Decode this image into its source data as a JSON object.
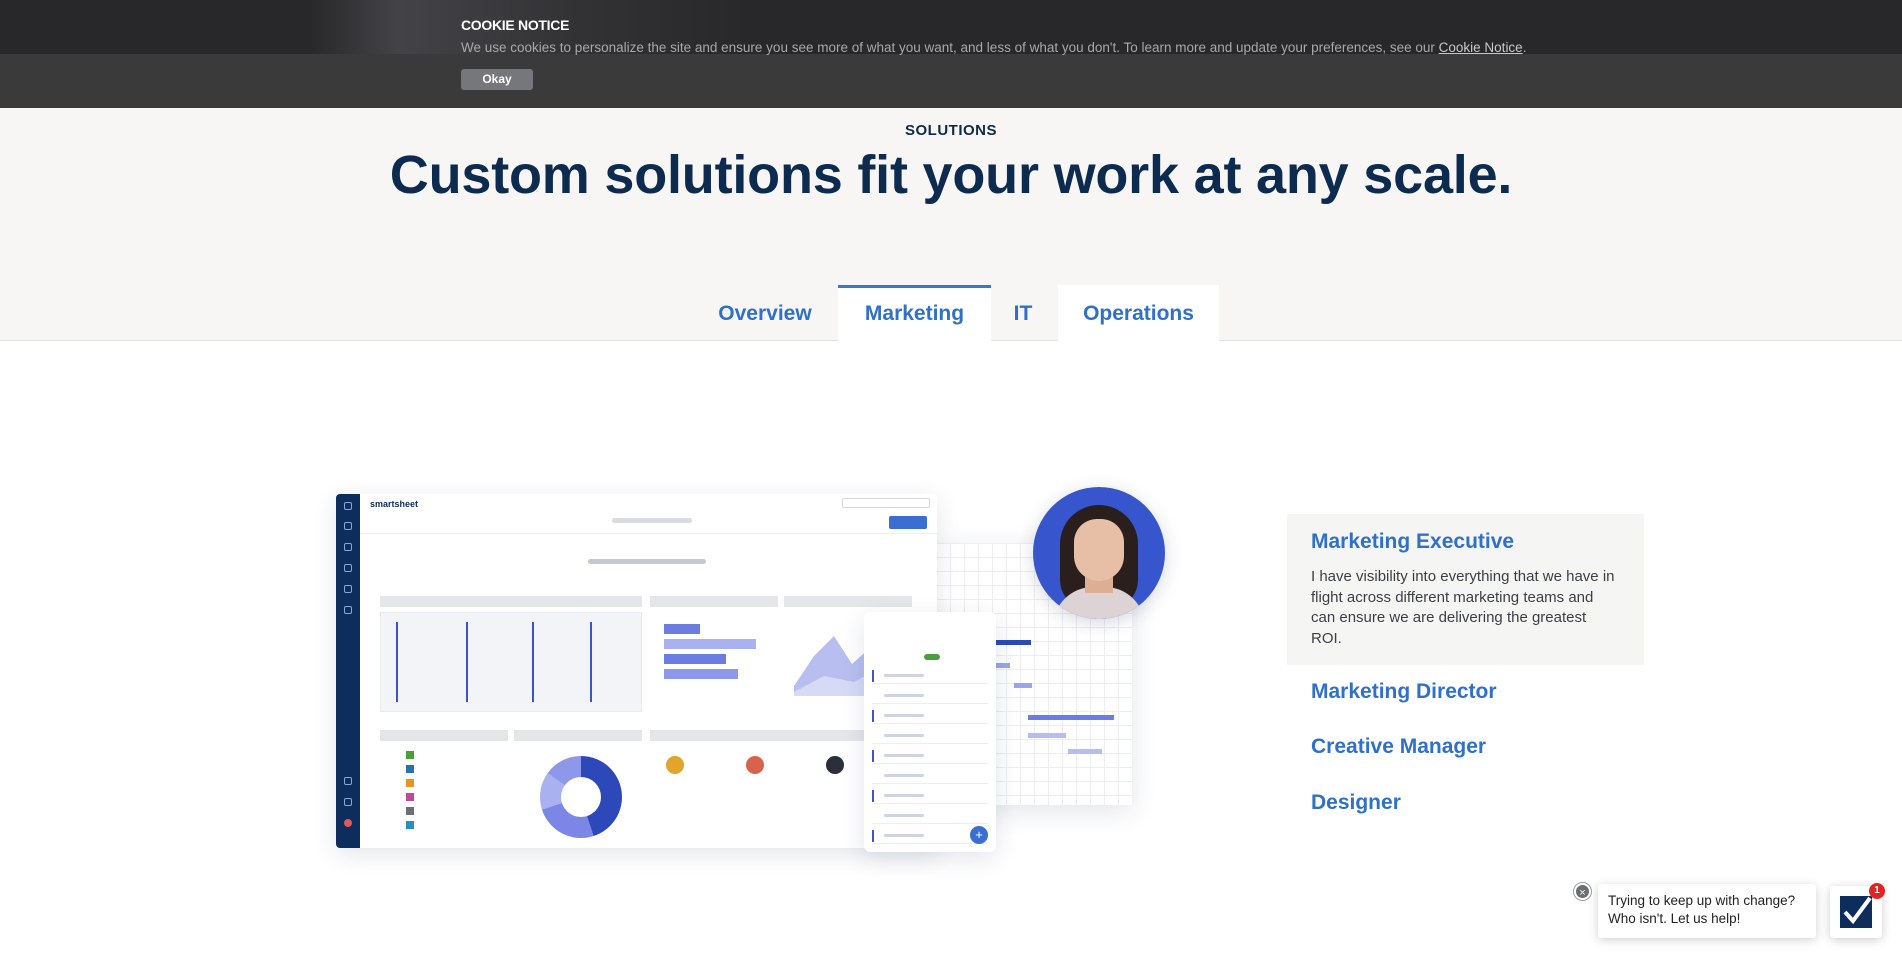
{
  "cookie": {
    "title": "COOKIE NOTICE",
    "text": "We use cookies to personalize the site and ensure you see more of what you want, and less of what you don't. To learn more and update your preferences, see our ",
    "link": "Cookie Notice",
    "period": ".",
    "button": "Okay"
  },
  "hero": {
    "eyebrow": "SOLUTIONS",
    "headline": "Custom solutions fit your work at any scale."
  },
  "tabs": [
    {
      "label": "Overview",
      "active": false
    },
    {
      "label": "Marketing",
      "active": true
    },
    {
      "label": "IT",
      "active": false
    },
    {
      "label": "Operations",
      "active": false
    }
  ],
  "illustration": {
    "app_name": "smartsheet"
  },
  "personas": [
    {
      "title": "Marketing Executive",
      "active": true,
      "description": "I have visibility into everything that we have in flight across different marketing teams and can ensure we are delivering the greatest ROI."
    },
    {
      "title": "Marketing Director",
      "active": false
    },
    {
      "title": "Creative Manager",
      "active": false
    },
    {
      "title": "Designer",
      "active": false
    }
  ],
  "chat": {
    "line1": "Trying to keep up with change?",
    "line2": "Who isn't. Let us help!",
    "badge": "1",
    "close_icon": "close-icon",
    "launcher_icon": "smartsheet-checkmark-icon"
  },
  "colors": {
    "accent": "#2f70c9",
    "navy": "#0c2b4e",
    "banner": "#3a3a3b"
  }
}
